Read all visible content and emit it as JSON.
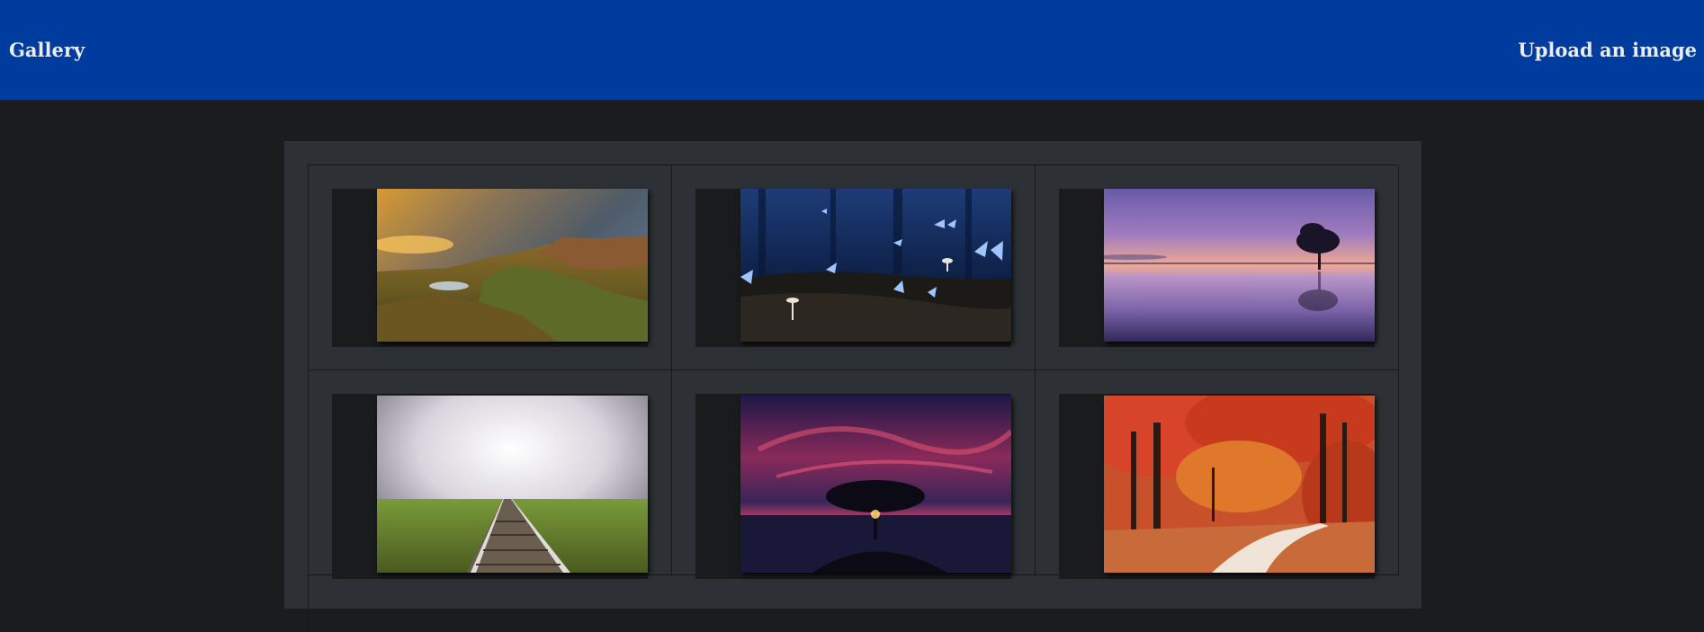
{
  "navbar": {
    "brand": "Gallery",
    "upload_link": "Upload an image",
    "background_color": "#003c9e"
  },
  "gallery": {
    "images": [
      {
        "subject": "mountain-sunset-landscape"
      },
      {
        "subject": "blue-butterflies-forest-mushrooms"
      },
      {
        "subject": "lone-tree-purple-lake"
      },
      {
        "subject": "railway-tracks-cloudy-field"
      },
      {
        "subject": "tree-silhouette-red-sky"
      },
      {
        "subject": "autumn-red-forest-path"
      }
    ]
  }
}
